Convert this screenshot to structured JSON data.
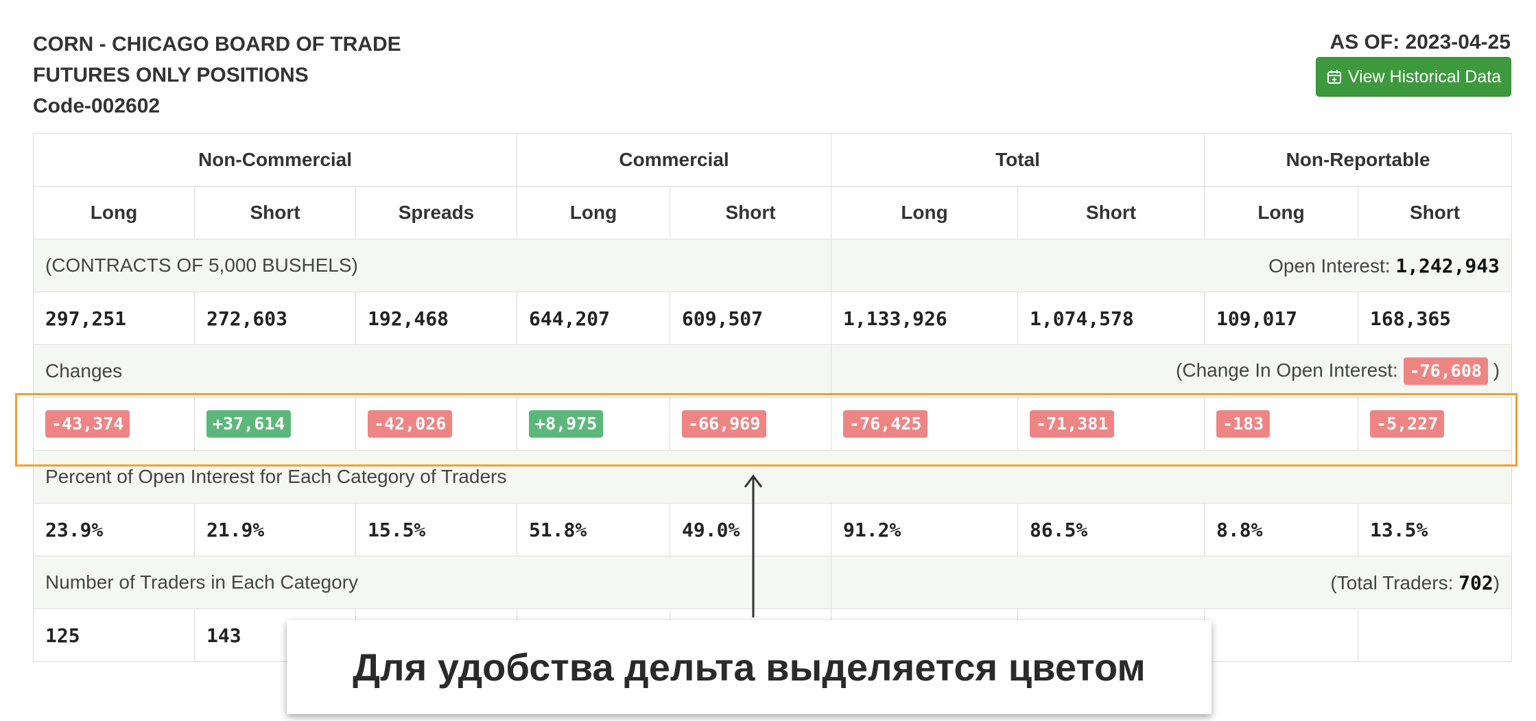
{
  "header": {
    "title_line1": "CORN - CHICAGO BOARD OF TRADE",
    "title_line2": "FUTURES ONLY POSITIONS",
    "code": "Code-002602",
    "as_of": "AS OF: 2023-04-25",
    "historical_button": "View Historical Data",
    "historical_button_icon": "calendar-plus-icon"
  },
  "table": {
    "groups": [
      "Non-Commercial",
      "Commercial",
      "Total",
      "Non-Reportable"
    ],
    "columns": [
      "Long",
      "Short",
      "Spreads",
      "Long",
      "Short",
      "Long",
      "Short",
      "Long",
      "Short"
    ],
    "contracts_label": "(CONTRACTS OF 5,000 BUSHELS)",
    "open_interest_label": "Open Interest: ",
    "open_interest_value": "1,242,943",
    "positions": [
      "297,251",
      "272,603",
      "192,468",
      "644,207",
      "609,507",
      "1,133,926",
      "1,074,578",
      "109,017",
      "168,365"
    ],
    "changes_label": "Changes",
    "change_oi_label": "(Change In Open Interest: ",
    "change_oi_value": "-76,608",
    "change_oi_close": " )",
    "changes": [
      "-43,374",
      "+37,614",
      "-42,026",
      "+8,975",
      "-66,969",
      "-76,425",
      "-71,381",
      "-183",
      "-5,227"
    ],
    "percent_label": "Percent of Open Interest for Each Category of Traders",
    "percents": [
      "23.9%",
      "21.9%",
      "15.5%",
      "51.8%",
      "49.0%",
      "91.2%",
      "86.5%",
      "8.8%",
      "13.5%"
    ],
    "traders_label": "Number of Traders in Each Category",
    "total_traders_label": "(Total Traders: ",
    "total_traders_value": "702",
    "total_traders_close": ")",
    "traders": [
      "125",
      "143",
      "",
      "",
      "",
      "",
      "",
      "",
      ""
    ]
  },
  "caption": "Для удобства дельта выделяется цветом",
  "colors": {
    "negative": "#ee8585",
    "positive": "#5cb87a",
    "highlight": "#f0a030",
    "button": "#3c9a3c"
  }
}
